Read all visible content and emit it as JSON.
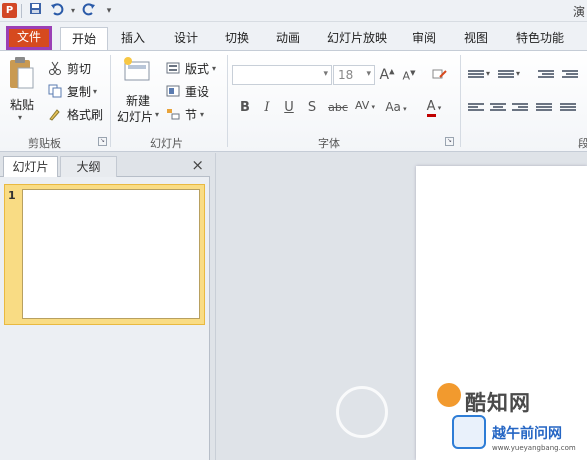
{
  "qat": {
    "app_icon": "P",
    "save_icon": "save-icon",
    "undo_icon": "undo-icon",
    "redo_icon": "redo-icon",
    "title": "演"
  },
  "tabs": [
    {
      "label": "文件"
    },
    {
      "label": "开始"
    },
    {
      "label": "插入"
    },
    {
      "label": "设计"
    },
    {
      "label": "切换"
    },
    {
      "label": "动画"
    },
    {
      "label": "幻灯片放映"
    },
    {
      "label": "审阅"
    },
    {
      "label": "视图"
    },
    {
      "label": "特色功能"
    }
  ],
  "clipboard": {
    "paste_label": "粘贴",
    "cut_label": "剪切",
    "copy_label": "复制",
    "format_painter_label": "格式刷",
    "group_label": "剪贴板"
  },
  "slides_group": {
    "new_slide_line1": "新建",
    "new_slide_line2": "幻灯片",
    "layout_label": "版式",
    "reset_label": "重设",
    "section_label": "节",
    "group_label": "幻灯片"
  },
  "font_group": {
    "font_size": "18",
    "grow_font": "A",
    "shrink_font": "A",
    "bold": "B",
    "italic": "I",
    "underline": "U",
    "shadow": "S",
    "strikethrough": "abc",
    "spacing": "AV",
    "change_case": "Aa",
    "font_color": "A",
    "group_label": "字体"
  },
  "paragraph_group": {
    "label": "段"
  },
  "pane": {
    "tab_slides": "幻灯片",
    "tab_outline": "大纲",
    "close": "×",
    "slide_number": "1"
  },
  "watermark": {
    "site_name": "酷知网",
    "site_name2": "越午前问网",
    "site_url": "www.yueyangbang.com"
  },
  "colors": {
    "file_tab": "#d64a1e",
    "file_tab_border": "#9b3fb5",
    "thumb_highlight": "#f9dc84"
  }
}
